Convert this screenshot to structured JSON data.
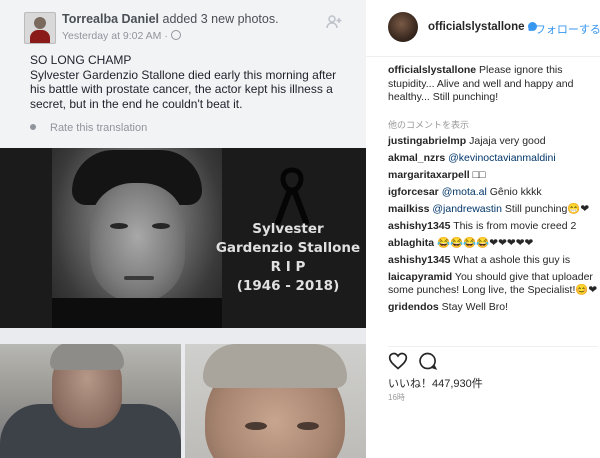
{
  "facebook": {
    "author": "Torrealba Daniel",
    "action": " added 3 new photos.",
    "timestamp": "Yesterday at 9:02 AM ·",
    "post_lines": [
      "SO LONG CHAMP",
      "Sylvester Gardenzio Stallone died early this morning after his battle with prostate cancer, the actor kept his illness a secret, but in the end he couldn't beat it."
    ],
    "translate": "Rate this translation",
    "rip_card": {
      "line1": "Sylvester",
      "line2": "Gardenzio Stallone",
      "line3": "R I P",
      "line4": "(1946 - 2018)"
    }
  },
  "instagram": {
    "username": "officialslystallone",
    "follow_label": "フォローする",
    "caption_user": "officialslystallone",
    "caption_text": " Please ignore this stupidity... Alive and well and happy and healthy... Still punching!",
    "translate_label": "他のコメントを表示",
    "comments": [
      {
        "user": "justingabrielmp",
        "mention": "",
        "text": " Jajaja very good"
      },
      {
        "user": "akmal_nzrs",
        "mention": " @kevinoctavianmaldini",
        "text": ""
      },
      {
        "user": "margaritaxarpell",
        "mention": "",
        "text": " □□"
      },
      {
        "user": "igforcesar",
        "mention": " @mota.al",
        "text": " Gênio kkkk"
      },
      {
        "user": "mailkiss",
        "mention": " @jandrewastin",
        "text": " Still punching😁❤"
      },
      {
        "user": "ashishy1345",
        "mention": "",
        "text": " This is from movie creed 2"
      },
      {
        "user": "ablaghita",
        "mention": "",
        "text": " 😂😂😂😂❤❤❤❤❤"
      },
      {
        "user": "ashishy1345",
        "mention": "",
        "text": " What a ashole this guy is"
      },
      {
        "user": "laicapyramid",
        "mention": "",
        "text": " You should give that uploader some punches! Long live, the Specialist!😊❤"
      },
      {
        "user": "gridendos",
        "mention": "",
        "text": " Stay Well Bro!"
      }
    ],
    "likes": "いいね！447,930件",
    "date": "16時"
  }
}
